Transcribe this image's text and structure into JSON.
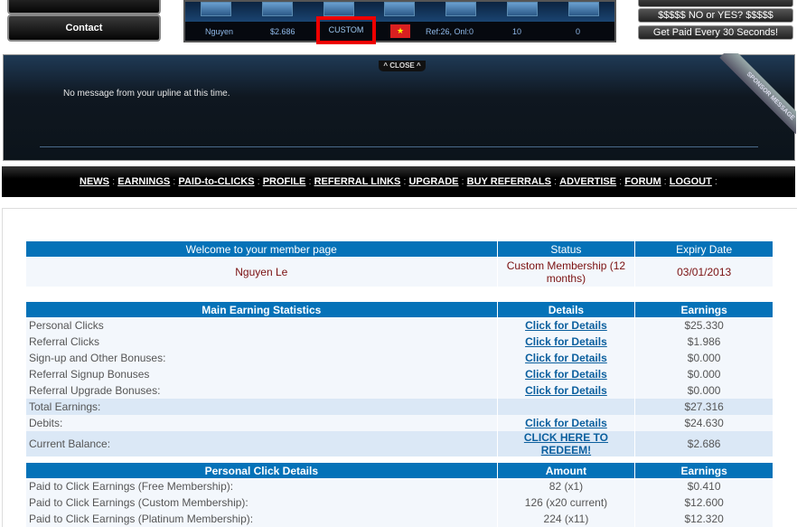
{
  "top": {
    "contact": "Contact",
    "stats": {
      "name": "Nguyen",
      "balance": "$2.686",
      "membership": "CUSTOM",
      "refs": "Ref:26, Onl:0",
      "val1": "10",
      "val2": "0"
    },
    "right_buttons": [
      "$$$$$ NO or YES? $$$$$",
      "Get Paid Every 30 Seconds!"
    ]
  },
  "sponsor": {
    "close": "^ CLOSE ^",
    "message": "No message from your upline at this time.",
    "ribbon": "SPONSOR MESSAGE"
  },
  "nav": [
    "NEWS",
    "EARNINGS",
    "PAID-to-CLICKS",
    "PROFILE",
    "REFERRAL LINKS",
    "UPGRADE",
    "BUY REFERRALS",
    "ADVERTISE",
    "FORUM",
    "LOGOUT"
  ],
  "welcome": {
    "headers": [
      "Welcome to your member page",
      "Status",
      "Expiry Date"
    ],
    "name": "Nguyen Le",
    "status": "Custom Membership (12 months)",
    "expiry": "03/01/2013"
  },
  "main": {
    "headers": [
      "Main Earning Statistics",
      "Details",
      "Earnings"
    ],
    "rows": [
      {
        "label": "Personal Clicks",
        "details": "Click for Details",
        "earnings": "$25.330"
      },
      {
        "label": "Referral Clicks",
        "details": "Click for Details",
        "earnings": "$1.986"
      },
      {
        "label": "Sign-up and Other Bonuses:",
        "details": "Click for Details",
        "earnings": "$0.000"
      },
      {
        "label": "Referral Signup Bonuses",
        "details": "Click for Details",
        "earnings": "$0.000"
      },
      {
        "label": "Referral Upgrade Bonuses:",
        "details": "Click for Details",
        "earnings": "$0.000"
      },
      {
        "label": "Total Earnings:",
        "details": "",
        "earnings": "$27.316"
      },
      {
        "label": "Debits:",
        "details": "Click for Details",
        "earnings": "$24.630"
      },
      {
        "label": "Current Balance:",
        "details": "CLICK HERE TO REDEEM!",
        "earnings": "$2.686"
      }
    ]
  },
  "personal": {
    "headers": [
      "Personal Click Details",
      "Amount",
      "Earnings"
    ],
    "rows": [
      {
        "label": "Paid to Click Earnings (Free Membership):",
        "amount": "82 (x1)",
        "earnings": "$0.410"
      },
      {
        "label": "Paid to Click Earnings (Custom Membership):",
        "amount": "126 (x20 current)",
        "earnings": "$12.600"
      },
      {
        "label": "Paid to Click Earnings (Platinum Membership):",
        "amount": "224 (x11)",
        "earnings": "$12.320"
      }
    ]
  }
}
